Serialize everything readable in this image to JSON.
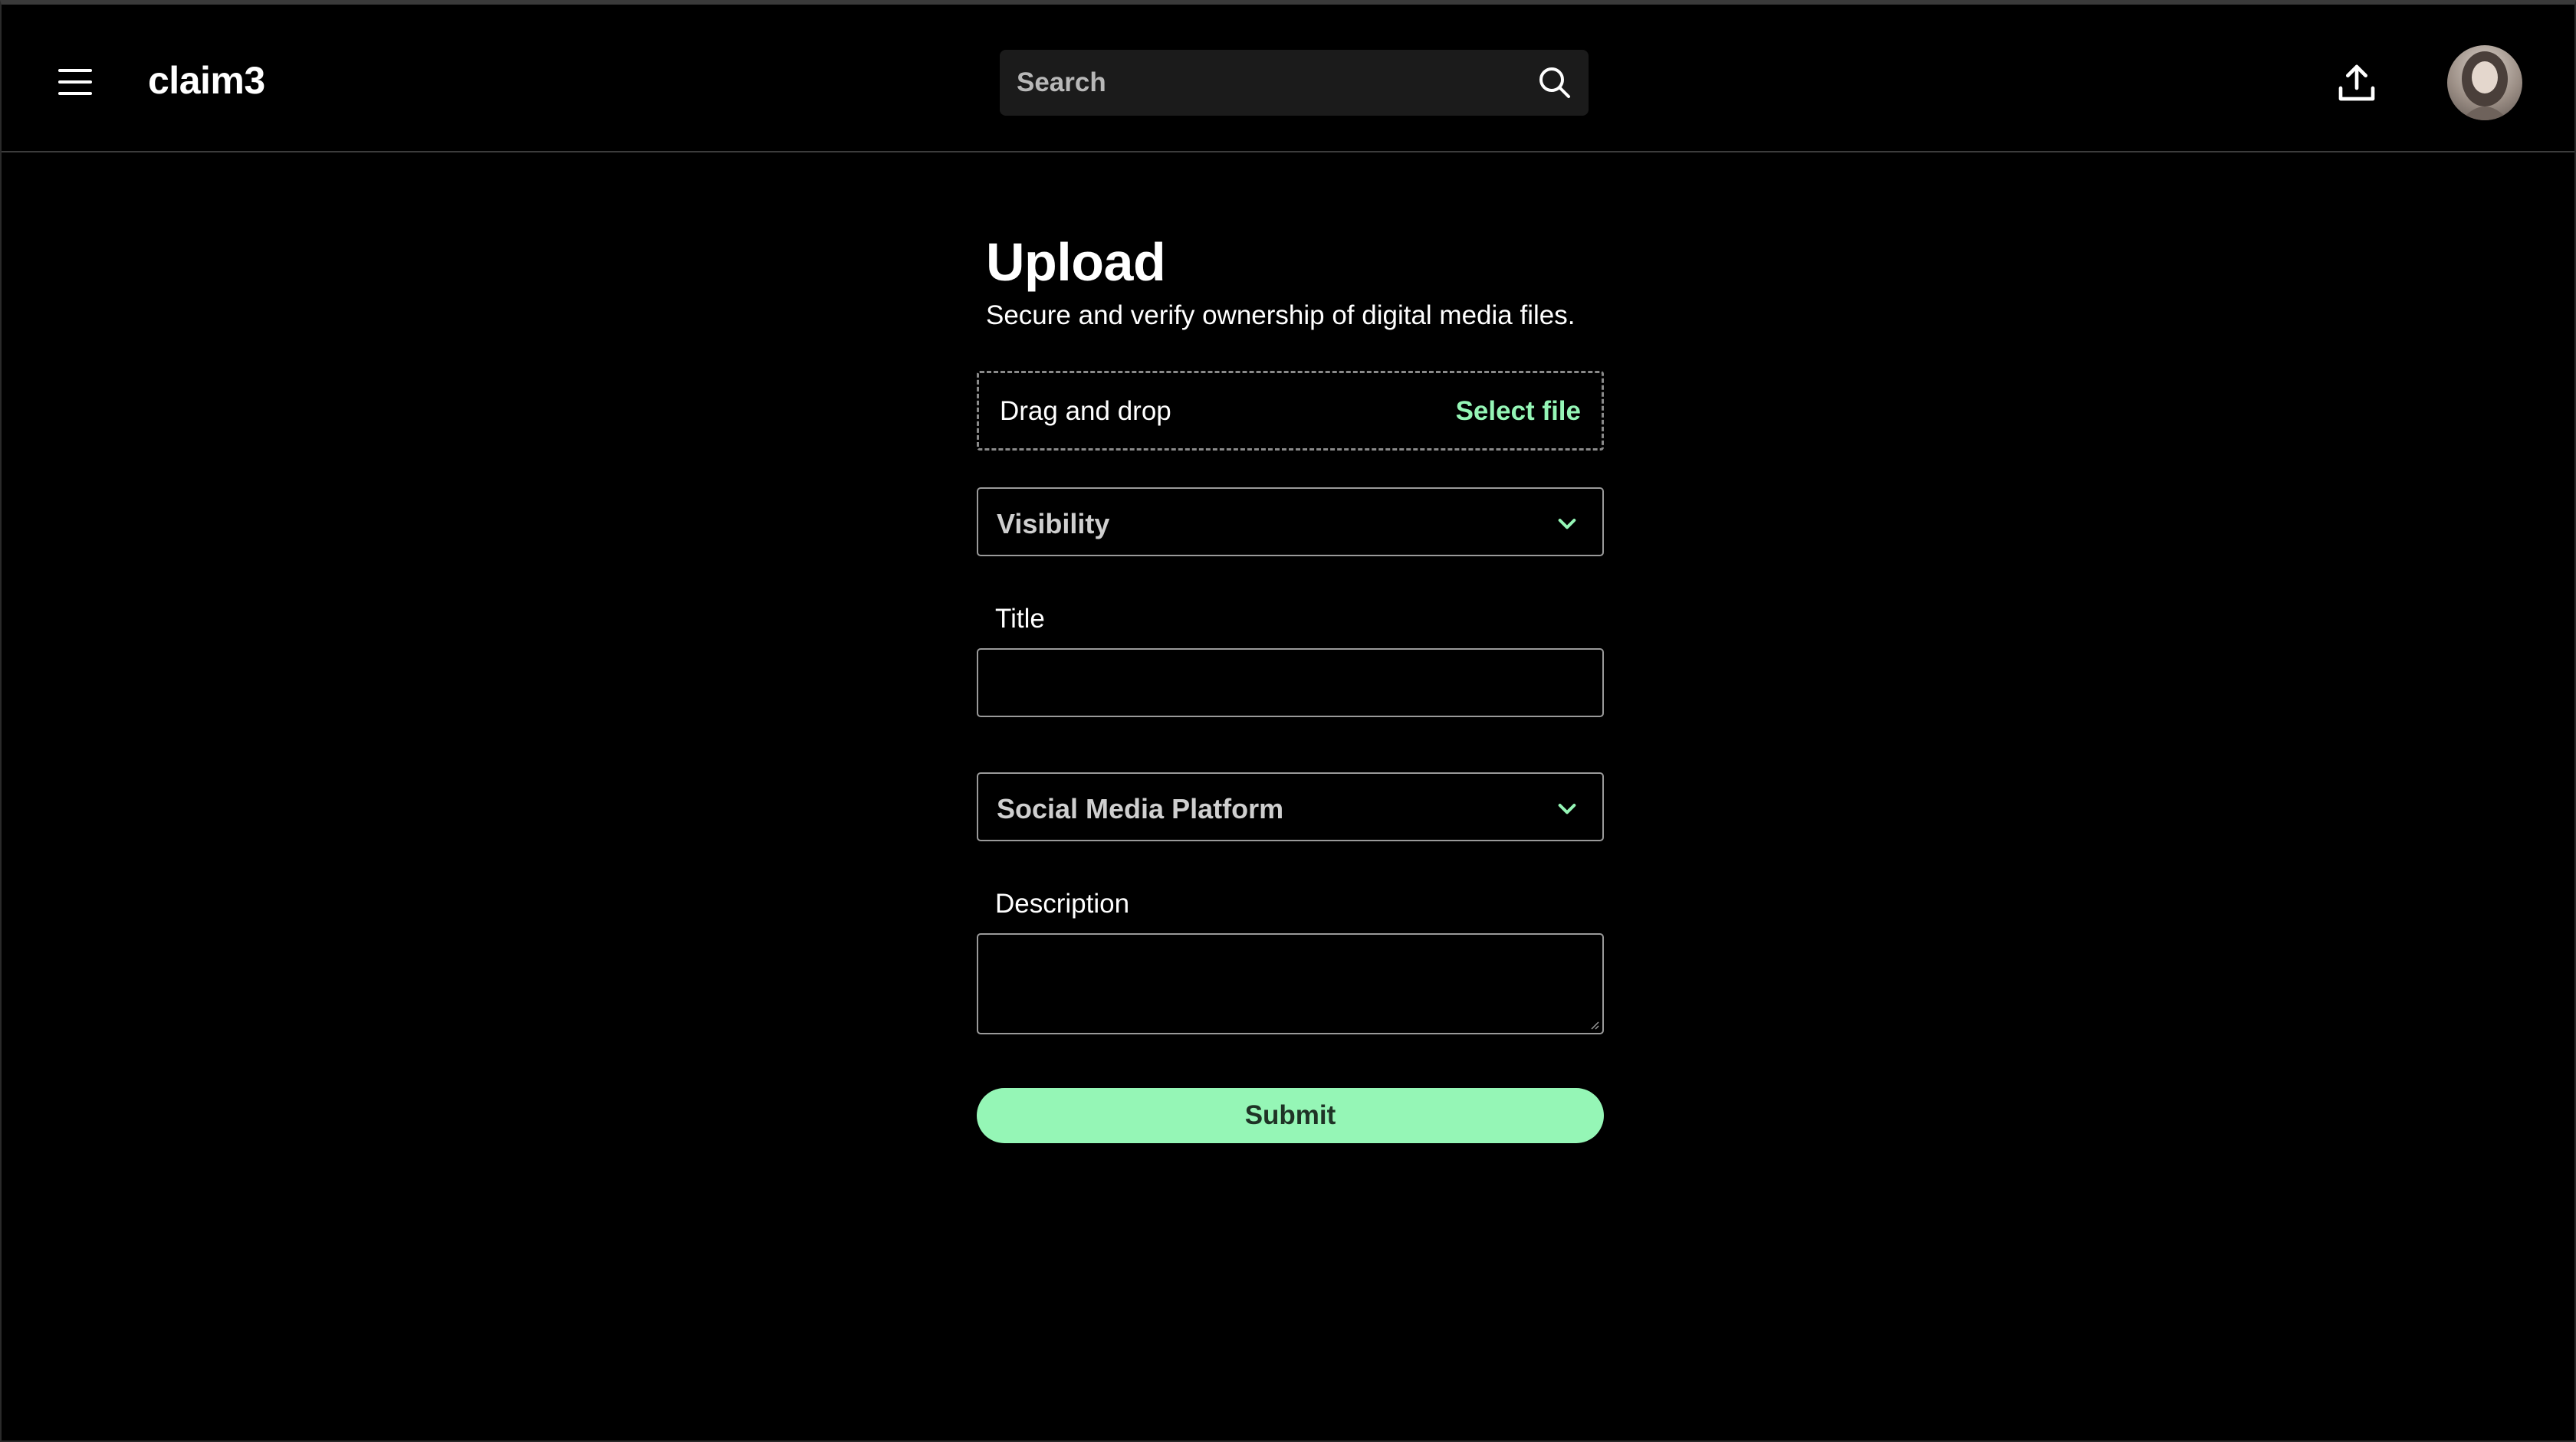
{
  "header": {
    "brand": "claim3",
    "search": {
      "placeholder": "Search",
      "value": ""
    },
    "icons": {
      "menu": "hamburger-menu-icon",
      "search": "search-icon",
      "upload": "upload-icon",
      "avatar": "user-avatar"
    }
  },
  "form": {
    "title": "Upload",
    "subtitle": "Secure and verify ownership of digital media files.",
    "dropzone": {
      "text": "Drag and drop",
      "select_label": "Select file"
    },
    "visibility": {
      "placeholder": "Visibility"
    },
    "title_field": {
      "label": "Title",
      "value": ""
    },
    "platform": {
      "placeholder": "Social Media Platform"
    },
    "description": {
      "label": "Description",
      "value": ""
    },
    "submit_label": "Submit"
  },
  "colors": {
    "background": "#000000",
    "accent": "#95f6b6",
    "border": "#9a9a9a",
    "search_bg": "#1b1b1b"
  }
}
